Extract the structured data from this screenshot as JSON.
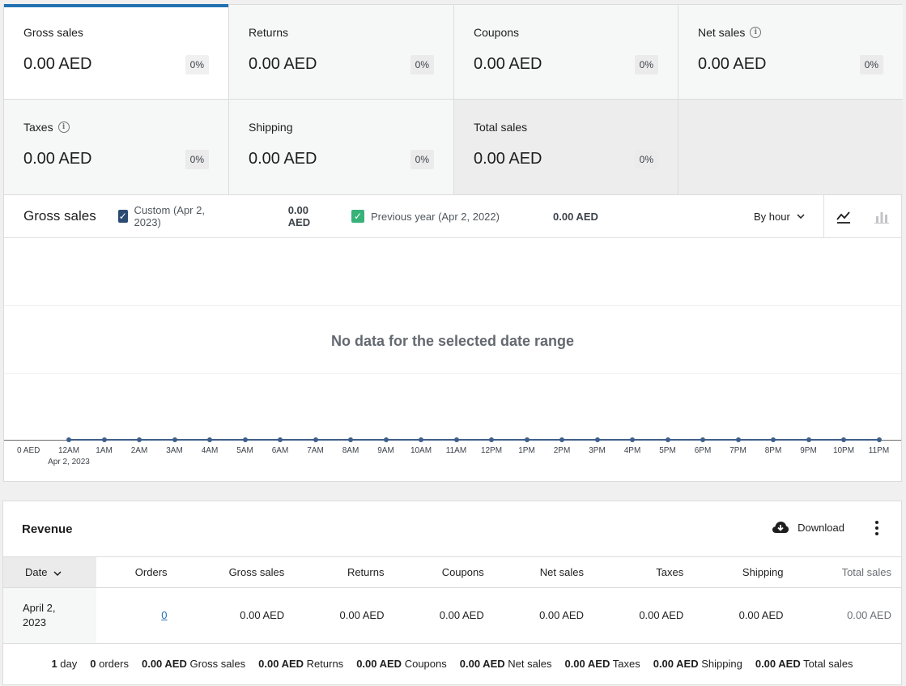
{
  "tiles": [
    {
      "label": "Gross sales",
      "value": "0.00 AED",
      "delta": "0%",
      "info": false
    },
    {
      "label": "Returns",
      "value": "0.00 AED",
      "delta": "0%",
      "info": false
    },
    {
      "label": "Coupons",
      "value": "0.00 AED",
      "delta": "0%",
      "info": false
    },
    {
      "label": "Net sales",
      "value": "0.00 AED",
      "delta": "0%",
      "info": true
    },
    {
      "label": "Taxes",
      "value": "0.00 AED",
      "delta": "0%",
      "info": true
    },
    {
      "label": "Shipping",
      "value": "0.00 AED",
      "delta": "0%",
      "info": false
    },
    {
      "label": "Total sales",
      "value": "0.00 AED",
      "delta": "0%",
      "info": false
    }
  ],
  "chart": {
    "title": "Gross sales",
    "legend": [
      {
        "label": "Custom (Apr 2, 2023)",
        "value": "0.00 AED",
        "color": "#2b4b73"
      },
      {
        "label": "Previous year (Apr 2, 2022)",
        "value": "0.00 AED",
        "color": "#37b37a"
      }
    ],
    "interval": "By hour",
    "no_data": "No data for the selected date range"
  },
  "chart_data": {
    "type": "line",
    "x": [
      "12AM",
      "1AM",
      "2AM",
      "3AM",
      "4AM",
      "5AM",
      "6AM",
      "7AM",
      "8AM",
      "9AM",
      "10AM",
      "11AM",
      "12PM",
      "1PM",
      "2PM",
      "3PM",
      "4PM",
      "5PM",
      "6PM",
      "7PM",
      "8PM",
      "9PM",
      "10PM",
      "11PM"
    ],
    "x_sublabel": "Apr 2, 2023",
    "y_label": "0 AED",
    "series": [
      {
        "name": "Custom (Apr 2, 2023)",
        "values": [
          0,
          0,
          0,
          0,
          0,
          0,
          0,
          0,
          0,
          0,
          0,
          0,
          0,
          0,
          0,
          0,
          0,
          0,
          0,
          0,
          0,
          0,
          0,
          0
        ]
      }
    ]
  },
  "revenue": {
    "title": "Revenue",
    "download": "Download",
    "columns": [
      "Date",
      "Orders",
      "Gross sales",
      "Returns",
      "Coupons",
      "Net sales",
      "Taxes",
      "Shipping",
      "Total sales"
    ],
    "row": {
      "date_line1": "April 2,",
      "date_line2": "2023",
      "orders": "0",
      "gross": "0.00 AED",
      "returns": "0.00 AED",
      "coupons": "0.00 AED",
      "net": "0.00 AED",
      "taxes": "0.00 AED",
      "shipping": "0.00 AED",
      "total": "0.00 AED"
    },
    "summary": [
      {
        "value": "1",
        "label": "day"
      },
      {
        "value": "0",
        "label": "orders"
      },
      {
        "value": "0.00 AED",
        "label": "Gross sales"
      },
      {
        "value": "0.00 AED",
        "label": "Returns"
      },
      {
        "value": "0.00 AED",
        "label": "Coupons"
      },
      {
        "value": "0.00 AED",
        "label": "Net sales"
      },
      {
        "value": "0.00 AED",
        "label": "Taxes"
      },
      {
        "value": "0.00 AED",
        "label": "Shipping"
      },
      {
        "value": "0.00 AED",
        "label": "Total sales"
      }
    ]
  }
}
